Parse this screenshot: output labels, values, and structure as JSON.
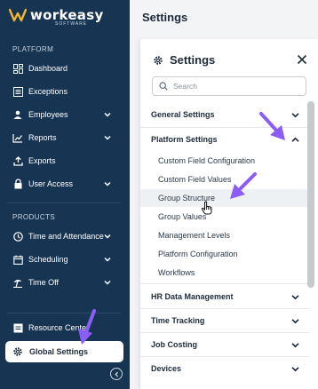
{
  "brand": {
    "name": "workeasy",
    "sub": "SOFTWARE"
  },
  "sidebar": {
    "platform_label": "PLATFORM",
    "platform_items": [
      {
        "label": "Dashboard",
        "icon": "dashboard-icon"
      },
      {
        "label": "Exceptions",
        "icon": "exceptions-icon"
      },
      {
        "label": "Employees",
        "icon": "employees-icon"
      },
      {
        "label": "Reports",
        "icon": "reports-icon"
      },
      {
        "label": "Exports",
        "icon": "exports-icon"
      },
      {
        "label": "User Access",
        "icon": "lock-icon"
      }
    ],
    "products_label": "PRODUCTS",
    "product_items": [
      {
        "label": "Time and Attendance",
        "icon": "clock-icon"
      },
      {
        "label": "Scheduling",
        "icon": "calendar-icon"
      },
      {
        "label": "Time Off",
        "icon": "beach-icon"
      }
    ],
    "resource_center": "Resource Center",
    "global_settings": "Global Settings"
  },
  "page": {
    "title": "Settings"
  },
  "settings_panel": {
    "title": "Settings",
    "search_placeholder": "Search",
    "groups": {
      "general": "General Settings",
      "platform": "Platform Settings",
      "hr": "HR Data Management",
      "time": "Time Tracking",
      "job": "Job Costing",
      "devices": "Devices"
    },
    "platform_items": [
      "Custom Field Configuration",
      "Custom Field Values",
      "Group Structure",
      "Group Values",
      "Management Levels",
      "Platform Configuration",
      "Workflows"
    ]
  },
  "colors": {
    "sidebar_bg": "#173553",
    "annotation_arrow": "#8b5cf6",
    "active_bg": "#ffffff"
  }
}
